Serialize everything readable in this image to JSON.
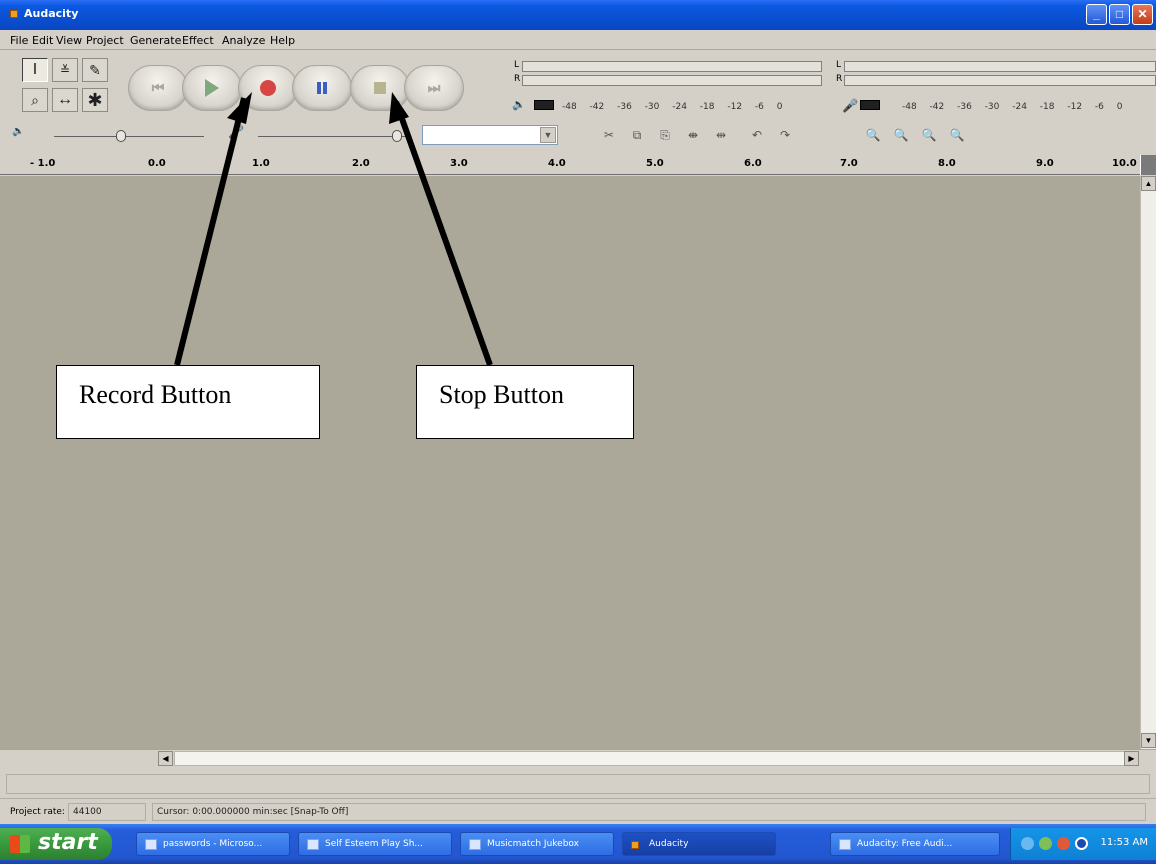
{
  "window": {
    "title": "Audacity"
  },
  "menu": [
    "File",
    "Edit",
    "View",
    "Project",
    "Generate",
    "Effect",
    "Analyze",
    "Help"
  ],
  "tools": [
    "selection-tool",
    "envelope-tool",
    "draw-tool",
    "zoom-tool",
    "timeshift-tool",
    "multi-tool"
  ],
  "transport": [
    "skip-to-start",
    "play",
    "record",
    "pause",
    "stop",
    "skip-to-end"
  ],
  "meters": {
    "lr": [
      "L",
      "R"
    ],
    "ticks": "-48 -42 -36 -30 -24 -18 -12 -6 0"
  },
  "ruler": {
    "labels": [
      "- 1.0",
      "0.0",
      "1.0",
      "2.0",
      "3.0",
      "4.0",
      "5.0",
      "6.0",
      "7.0",
      "8.0",
      "9.0",
      "10.0"
    ]
  },
  "status": {
    "project_rate_label": "Project rate:",
    "project_rate_value": "44100",
    "cursor": "Cursor: 0:00.000000 min:sec  [Snap-To Off]"
  },
  "taskbar": {
    "start": "start",
    "tasks": [
      "passwords - Microso...",
      "Self Esteem Play Sh...",
      "Musicmatch Jukebox",
      "Audacity",
      "Audacity: Free Audi..."
    ],
    "clock": "11:53 AM"
  },
  "annotations": {
    "record": "Record Button",
    "stop": "Stop Button"
  }
}
